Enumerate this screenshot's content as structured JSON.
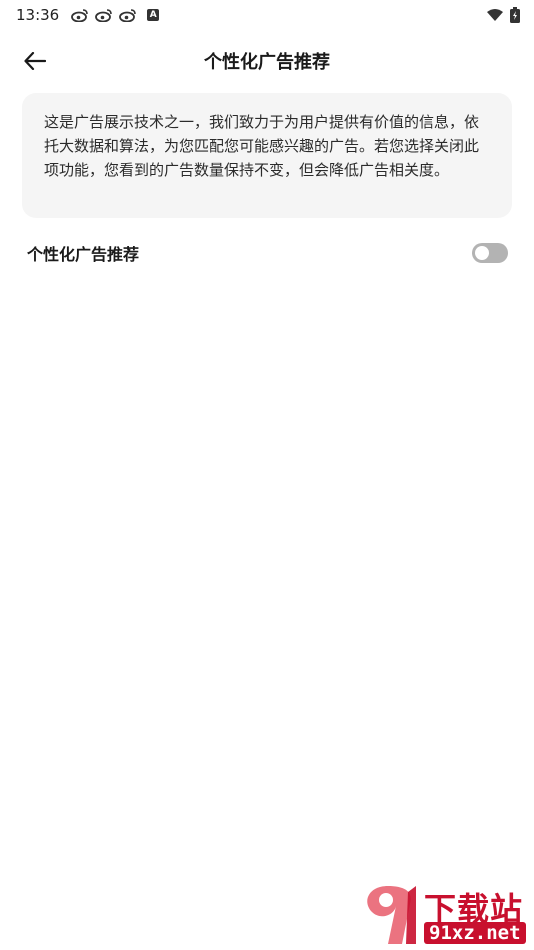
{
  "status_bar": {
    "time": "13:36",
    "icons": [
      "weibo-icon",
      "weibo-icon",
      "weibo-icon",
      "a-icon",
      "wifi-icon",
      "battery-icon"
    ],
    "a_label": "A"
  },
  "header": {
    "title": "个性化广告推荐",
    "back_icon": "back-arrow-icon"
  },
  "info": {
    "text": "这是广告展示技术之一，我们致力于为用户提供有价值的信息，依托大数据和算法，为您匹配您可能感兴趣的广告。若您选择关闭此项功能，您看到的广告数量保持不变，但会降低广告相关度。"
  },
  "setting": {
    "label": "个性化广告推荐",
    "enabled": false
  },
  "watermark": {
    "top": "下载站",
    "bottom": "91xz.net",
    "accent": "#c8102e"
  }
}
